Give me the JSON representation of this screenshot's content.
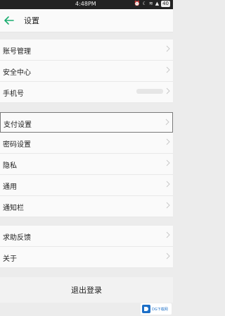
{
  "status_bar": {
    "time": "4:48PM",
    "battery": "40"
  },
  "header": {
    "title": "设置"
  },
  "groups": [
    {
      "items": [
        {
          "label": "账号管理"
        },
        {
          "label": "安全中心"
        },
        {
          "label": "手机号"
        }
      ]
    },
    {
      "items": [
        {
          "label": "支付设置"
        },
        {
          "label": "密码设置"
        },
        {
          "label": "隐私"
        },
        {
          "label": "通用"
        },
        {
          "label": "通知栏"
        }
      ]
    },
    {
      "items": [
        {
          "label": "求助反馈"
        },
        {
          "label": "关于"
        }
      ]
    }
  ],
  "logout": {
    "label": "退出登录"
  },
  "watermark": {
    "text": "DG下载网"
  },
  "colors": {
    "accent": "#1aad6f",
    "background": "#ececec",
    "row_background": "#fafafa"
  }
}
